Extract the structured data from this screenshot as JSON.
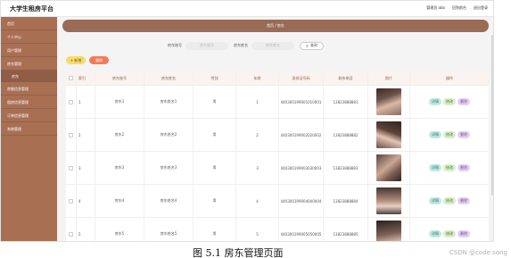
{
  "app_title": "大学生租房平台",
  "topbar": {
    "user_label": "管理员 abo",
    "front": "回到前台",
    "logout": "退出登录"
  },
  "sidebar": {
    "items": [
      {
        "label": "首页"
      },
      {
        "label": "个人中心"
      },
      {
        "label": "用户管理"
      },
      {
        "label": "房东管理"
      },
      {
        "label": "房东",
        "sub": true
      },
      {
        "label": "房屋信息管理"
      },
      {
        "label": "租房信息管理"
      },
      {
        "label": "订单信息管理"
      },
      {
        "label": "系统管理"
      }
    ]
  },
  "breadcrumb": "首页 / 房东",
  "search": {
    "field1_label": "房东账号",
    "field1_placeholder": "房东账号",
    "field2_label": "房东姓名",
    "field2_placeholder": "房东姓名",
    "button": "查询"
  },
  "actions": {
    "add": "+ 新增",
    "delete": "删除"
  },
  "table": {
    "headers": [
      "",
      "索引",
      "房东账号",
      "房东姓名",
      "性别",
      "年龄",
      "身份证号码",
      "联系电话",
      "照片",
      "操作"
    ],
    "rows": [
      {
        "index": "1",
        "account": "房东1",
        "name": "房东姓名1",
        "gender": "男",
        "age": "1",
        "id_no": "440300199001010001",
        "phone": "13823888881",
        "photo": "p1"
      },
      {
        "index": "2",
        "account": "房东2",
        "name": "房东姓名2",
        "gender": "男",
        "age": "2",
        "id_no": "440300199002020002",
        "phone": "13823888882",
        "photo": "p2"
      },
      {
        "index": "3",
        "account": "房东3",
        "name": "房东姓名3",
        "gender": "男",
        "age": "3",
        "id_no": "440300199003030003",
        "phone": "13823888883",
        "photo": "p3"
      },
      {
        "index": "4",
        "account": "房东4",
        "name": "房东姓名4",
        "gender": "男",
        "age": "4",
        "id_no": "440300199004040004",
        "phone": "13823888884",
        "photo": "p4"
      },
      {
        "index": "5",
        "account": "房东5",
        "name": "房东姓名5",
        "gender": "男",
        "age": "5",
        "id_no": "440300199005050005",
        "phone": "13823888885",
        "photo": "p5"
      }
    ],
    "row_buttons": {
      "detail": "详情",
      "edit": "修改",
      "remove": "删除"
    }
  },
  "caption": "图 5.1  房东管理页面",
  "watermark": "CSDN @code.song",
  "colors": {
    "sidebar": "#a86f53",
    "banner": "#9a6b55",
    "add": "#f6dc6a",
    "delete": "#f47a55"
  }
}
